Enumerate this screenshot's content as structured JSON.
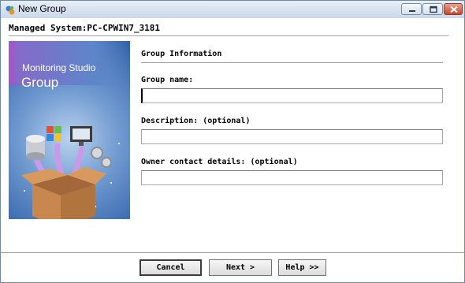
{
  "window": {
    "title": "New Group",
    "icon": "app-icon",
    "controls": [
      "minimize-icon",
      "maximize-icon",
      "close-icon"
    ]
  },
  "managed_system": "Managed System:PC-CPWIN7_3181",
  "banner": {
    "product": "Monitoring Studio",
    "heading": "Group"
  },
  "form": {
    "section_title": "Group Information",
    "group_name": {
      "label": "Group name:",
      "value": ""
    },
    "description": {
      "label": "Description: (optional)",
      "value": ""
    },
    "owner_contact": {
      "label": "Owner contact details: (optional)",
      "value": ""
    }
  },
  "buttons": {
    "cancel": "Cancel",
    "next": "Next >",
    "help": "Help >>"
  }
}
